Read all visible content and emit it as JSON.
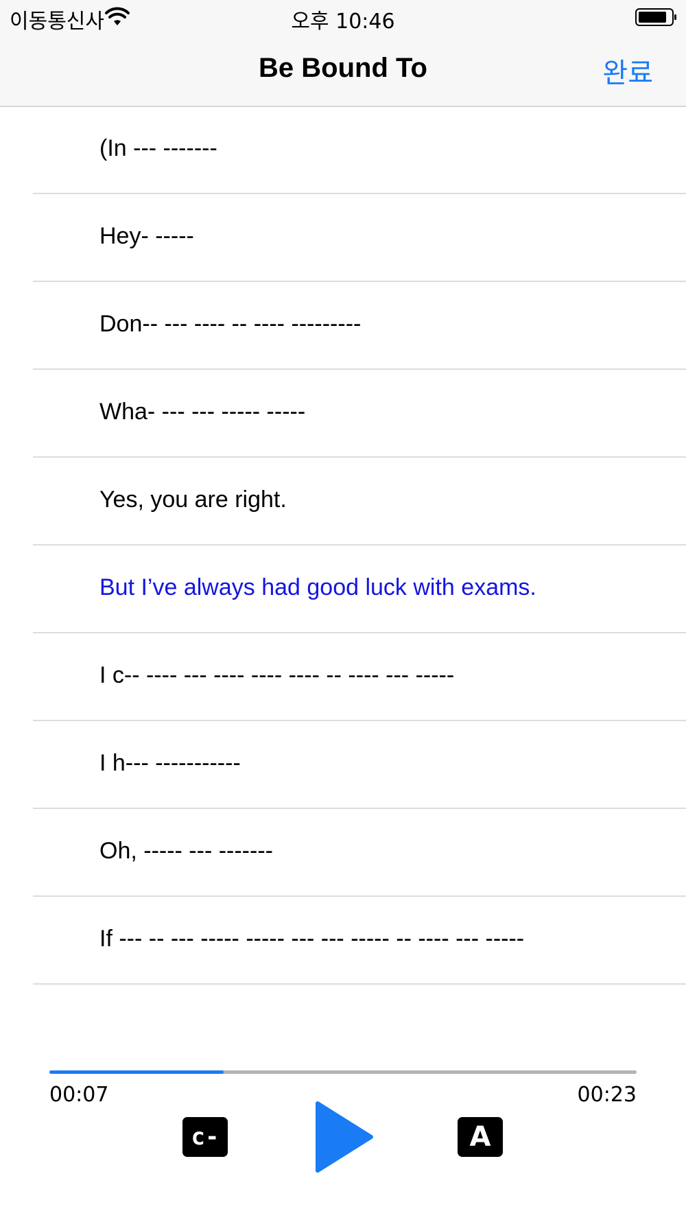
{
  "status_bar": {
    "carrier": "이동통신사",
    "time": "오후 10:46"
  },
  "nav": {
    "title": "Be Bound To",
    "done_label": "완료"
  },
  "lines": [
    {
      "text": "(In --- -------",
      "active": false
    },
    {
      "text": "Hey- -----",
      "active": false
    },
    {
      "text": "Don-- --- ---- -- ---- ---------",
      "active": false
    },
    {
      "text": "Wha- --- --- ----- -----",
      "active": false
    },
    {
      "text": "Yes, you are right.",
      "active": false
    },
    {
      "text": "But I’ve always had good luck with exams.",
      "active": true
    },
    {
      "text": "I c-- ---- --- ---- ---- ---- -- ---- --- -----",
      "active": false
    },
    {
      "text": "I h--- -----------",
      "active": false
    },
    {
      "text": "Oh, ----- --- -------",
      "active": false
    },
    {
      "text": "If --- -- --- ----- ----- --- --- ----- -- ---- --- -----",
      "active": false
    }
  ],
  "player": {
    "current_time": "00:07",
    "total_time": "00:23",
    "progress": 0.297,
    "caption_button_label": "c-",
    "answer_button_label": "A"
  },
  "colors": {
    "accent": "#1a7cf5",
    "active_line": "#1515e0"
  },
  "icons": {
    "wifi": "wifi-icon",
    "battery": "battery-icon",
    "play": "play-icon"
  }
}
